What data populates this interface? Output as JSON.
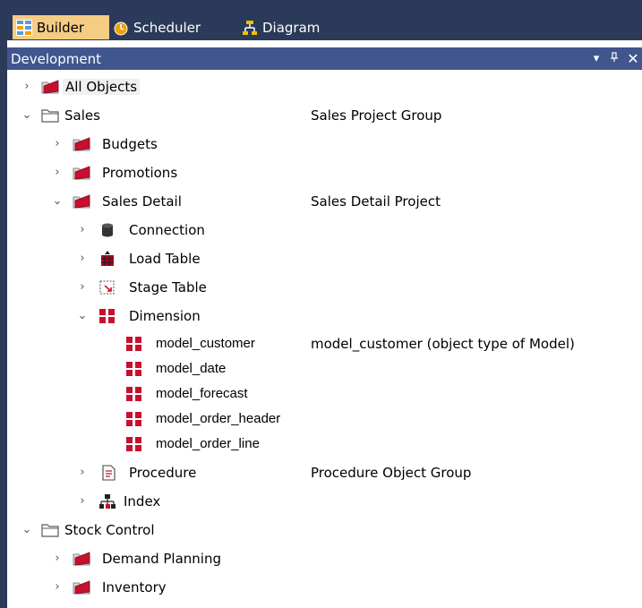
{
  "tabs": {
    "builder": "Builder",
    "scheduler": "Scheduler",
    "diagram": "Diagram"
  },
  "panel": {
    "title": "Development",
    "dropdown_glyph": "▾",
    "pin_glyph": "ᵖ",
    "close_glyph": "✕"
  },
  "tree": {
    "all_objects": "All Objects",
    "sales": "Sales",
    "sales_desc": "Sales Project Group",
    "budgets": "Budgets",
    "promotions": "Promotions",
    "sales_detail": "Sales Detail",
    "sales_detail_desc": "Sales Detail Project",
    "connection": "Connection",
    "load_table": "Load Table",
    "stage_table": "Stage Table",
    "dimension": "Dimension",
    "model_customer": "model_customer",
    "model_customer_desc": "model_customer (object type of Model)",
    "model_date": "model_date",
    "model_forecast": "model_forecast",
    "model_order_header": "model_order_header",
    "model_order_line": "model_order_line",
    "procedure": "Procedure",
    "procedure_desc": "Procedure Object Group",
    "index": "Index",
    "stock_control": "Stock Control",
    "demand_planning": "Demand Planning",
    "inventory": "Inventory"
  },
  "icons": {
    "folder_red": "folder-red-icon",
    "folder_grey": "folder-grey-icon",
    "database": "database-icon",
    "load_table": "load-table-icon",
    "stage_table": "stage-table-icon",
    "dimension": "dimension-grid-icon",
    "procedure": "procedure-doc-icon",
    "index": "index-tree-icon"
  },
  "colors": {
    "chrome_dark": "#2b3a58",
    "panel_header": "#40568d",
    "active_tab": "#f5cc84",
    "dimension_red": "#c8102e"
  }
}
